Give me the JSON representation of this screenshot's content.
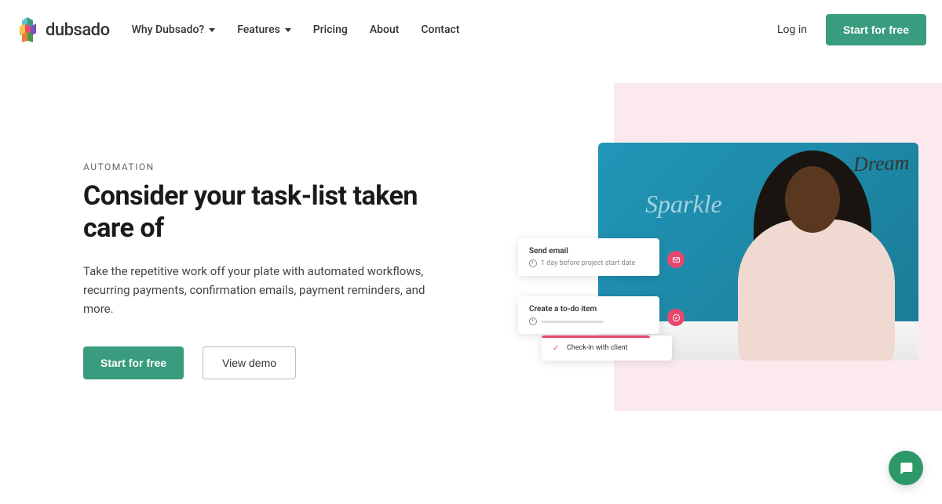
{
  "brand": "dubsado",
  "nav": {
    "items": [
      {
        "label": "Why Dubsado?",
        "dropdown": true
      },
      {
        "label": "Features",
        "dropdown": true
      },
      {
        "label": "Pricing",
        "dropdown": false
      },
      {
        "label": "About",
        "dropdown": false
      },
      {
        "label": "Contact",
        "dropdown": false
      }
    ]
  },
  "header": {
    "login": "Log in",
    "cta": "Start for free"
  },
  "hero": {
    "eyebrow": "AUTOMATION",
    "headline": "Consider your task-list taken care of",
    "subtext": "Take the repetitive work off your plate with automated workflows, recurring payments, confirmation emails, payment reminders, and more.",
    "cta_primary": "Start for free",
    "cta_secondary": "View demo"
  },
  "cards": {
    "c1": {
      "title": "Send email",
      "meta": "1 day before project start date"
    },
    "c2": {
      "title": "Create a to-do item"
    },
    "c3": {
      "text": "Check-in with client"
    }
  },
  "wall": {
    "dream": "Dream",
    "sparkle": "Sparkle"
  },
  "colors": {
    "primary": "#3a9c7e",
    "accent": "#e8476f",
    "bg_pink": "#fce9ee"
  }
}
